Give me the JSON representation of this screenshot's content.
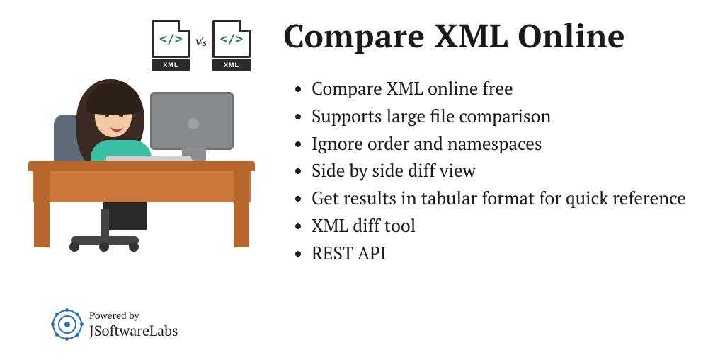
{
  "title": "Compare XML Online",
  "features": [
    "Compare XML online free",
    "Supports large file comparison",
    "Ignore order and namespaces",
    "Side by side diff view",
    "Get results in tabular format for quick reference",
    "XML diff tool",
    "REST API"
  ],
  "xml_icons": {
    "left_label": "XML",
    "vs_v": "v",
    "vs_s": "s",
    "right_label": "XML",
    "code_glyph": "</>"
  },
  "powered": {
    "label": "Powered by",
    "brand": "JSoftwareLabs"
  }
}
